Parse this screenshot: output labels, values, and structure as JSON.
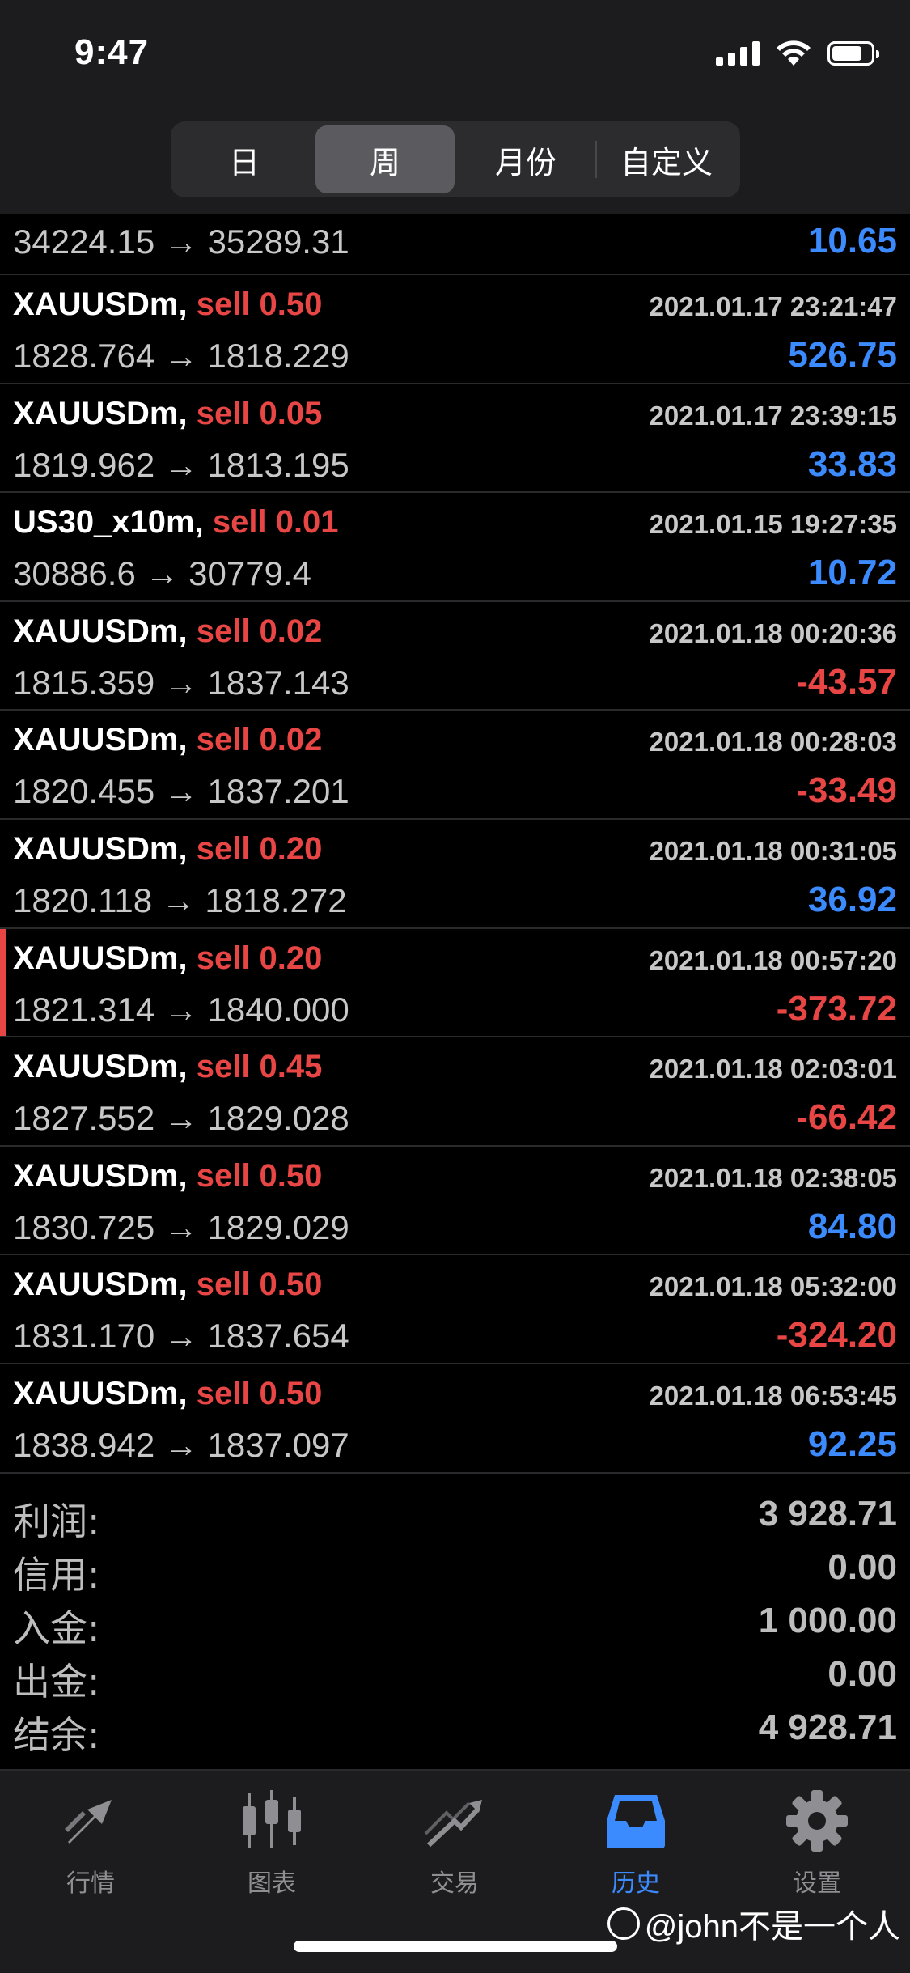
{
  "status_bar": {
    "time": "9:47"
  },
  "period_tabs": [
    {
      "label": "日",
      "active": false
    },
    {
      "label": "周",
      "active": true
    },
    {
      "label": "月份",
      "active": false
    },
    {
      "label": "自定义",
      "active": false
    }
  ],
  "first_row": {
    "prices": "34224.15 → 35289.31",
    "profit": "10.65"
  },
  "trades": [
    {
      "symbol": "XAUUSDm,",
      "side": "sell 0.50",
      "time": "2021.01.17 23:21:47",
      "prices": "1828.764 → 1818.229",
      "profit": "526.75",
      "positive": true
    },
    {
      "symbol": "XAUUSDm,",
      "side": "sell 0.05",
      "time": "2021.01.17 23:39:15",
      "prices": "1819.962 → 1813.195",
      "profit": "33.83",
      "positive": true
    },
    {
      "symbol": "US30_x10m,",
      "side": "sell 0.01",
      "time": "2021.01.15 19:27:35",
      "prices": "30886.6 → 30779.4",
      "profit": "10.72",
      "positive": true
    },
    {
      "symbol": "XAUUSDm,",
      "side": "sell 0.02",
      "time": "2021.01.18 00:20:36",
      "prices": "1815.359 → 1837.143",
      "profit": "-43.57",
      "positive": false
    },
    {
      "symbol": "XAUUSDm,",
      "side": "sell 0.02",
      "time": "2021.01.18 00:28:03",
      "prices": "1820.455 → 1837.201",
      "profit": "-33.49",
      "positive": false
    },
    {
      "symbol": "XAUUSDm,",
      "side": "sell 0.20",
      "time": "2021.01.18 00:31:05",
      "prices": "1820.118 → 1818.272",
      "profit": "36.92",
      "positive": true
    },
    {
      "symbol": "XAUUSDm,",
      "side": "sell 0.20",
      "time": "2021.01.18 00:57:20",
      "prices": "1821.314 → 1840.000",
      "profit": "-373.72",
      "positive": false,
      "marked": true
    },
    {
      "symbol": "XAUUSDm,",
      "side": "sell 0.45",
      "time": "2021.01.18 02:03:01",
      "prices": "1827.552 → 1829.028",
      "profit": "-66.42",
      "positive": false
    },
    {
      "symbol": "XAUUSDm,",
      "side": "sell 0.50",
      "time": "2021.01.18 02:38:05",
      "prices": "1830.725 → 1829.029",
      "profit": "84.80",
      "positive": true
    },
    {
      "symbol": "XAUUSDm,",
      "side": "sell 0.50",
      "time": "2021.01.18 05:32:00",
      "prices": "1831.170 → 1837.654",
      "profit": "-324.20",
      "positive": false
    },
    {
      "symbol": "XAUUSDm,",
      "side": "sell 0.50",
      "time": "2021.01.18 06:53:45",
      "prices": "1838.942 → 1837.097",
      "profit": "92.25",
      "positive": true
    }
  ],
  "summary": [
    {
      "label": "利润:",
      "value": "3 928.71"
    },
    {
      "label": "信用:",
      "value": "0.00"
    },
    {
      "label": "入金:",
      "value": "1 000.00"
    },
    {
      "label": "出金:",
      "value": "0.00"
    },
    {
      "label": "结余:",
      "value": "4 928.71"
    }
  ],
  "tabbar": [
    {
      "label": "行情",
      "icon": "quotes-icon",
      "active": false
    },
    {
      "label": "图表",
      "icon": "chart-icon",
      "active": false
    },
    {
      "label": "交易",
      "icon": "trade-icon",
      "active": false
    },
    {
      "label": "历史",
      "icon": "history-icon",
      "active": true
    },
    {
      "label": "设置",
      "icon": "settings-icon",
      "active": false
    }
  ],
  "watermark": "@john不是一个人",
  "colors": {
    "positive": "#3b8bff",
    "negative": "#e84545",
    "accent": "#3b8bff"
  }
}
